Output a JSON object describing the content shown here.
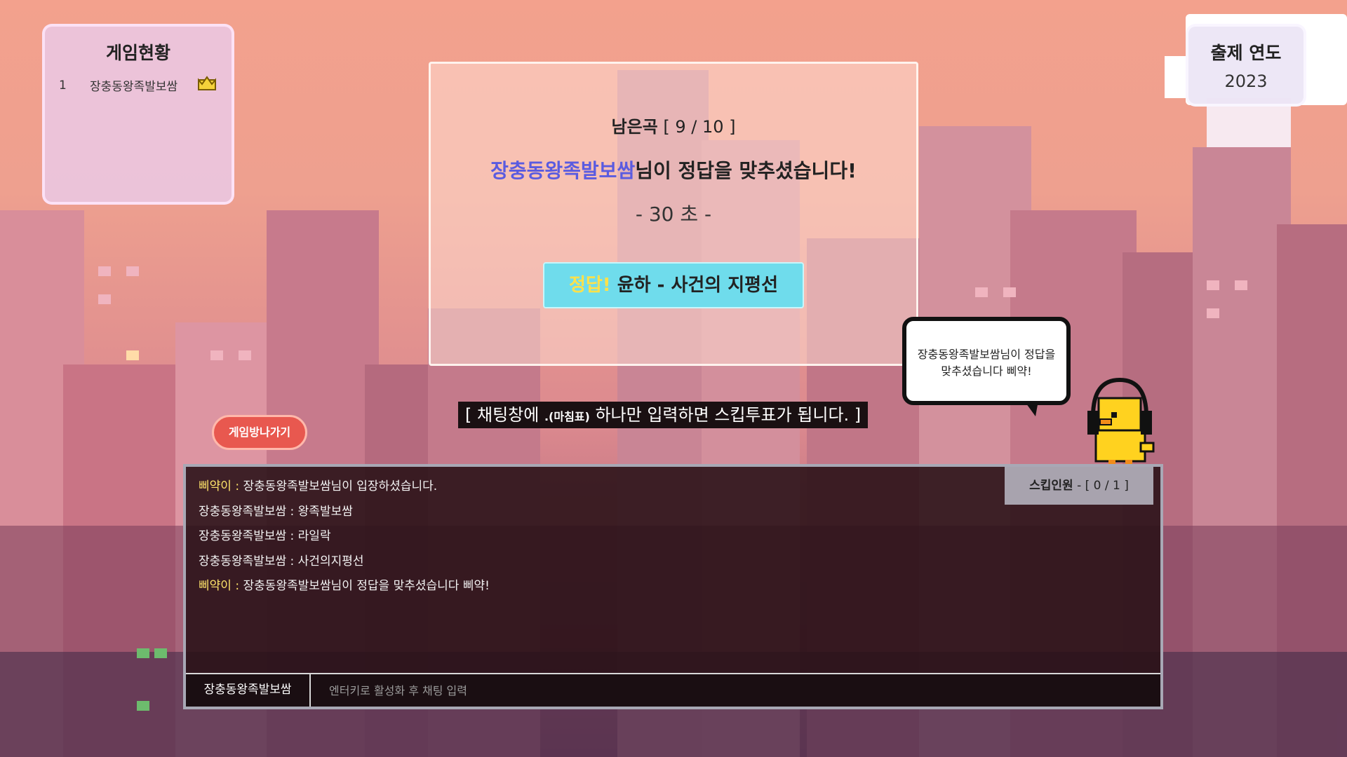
{
  "scoreboard": {
    "title": "게임현황",
    "players": [
      {
        "rank": "1",
        "name": "장충동왕족발보쌈"
      }
    ]
  },
  "year": {
    "title": "출제 연도",
    "value": "2023"
  },
  "panel": {
    "remaining_label": "남은곡",
    "remaining_value": "[ 9 / 10 ]",
    "winner_name": "장충동왕족발보쌈",
    "winner_suffix": "님이 정답을 맞추셨습니다!",
    "timer": "- 30 초 -",
    "answer_prefix": "정답!",
    "answer_text": "윤하 - 사건의 지평선"
  },
  "hint": {
    "pre": "[ 채팅창에 ",
    "dot": ".(마침표)",
    "post": " 하나만 입력하면 스킵투표가 됩니다. ]"
  },
  "leave_button": "게임방나가기",
  "bubble": {
    "line1": "장충동왕족발보쌈님이 정답을",
    "line2": "맞추셨습니다 삐약!"
  },
  "chat": {
    "messages": [
      {
        "sender": "삐약이",
        "sep": " : ",
        "text": "장충동왕족발보쌈님이 입장하셨습니다.",
        "system": true
      },
      {
        "sender": "장충동왕족발보쌈",
        "sep": " : ",
        "text": "왕족발보쌈",
        "system": false
      },
      {
        "sender": "장충동왕족발보쌈",
        "sep": " : ",
        "text": "라일락",
        "system": false
      },
      {
        "sender": "장충동왕족발보쌈",
        "sep": " : ",
        "text": "사건의지평선",
        "system": false
      },
      {
        "sender": "삐약이",
        "sep": " : ",
        "text": "장충동왕족발보쌈님이 정답을 맞추셨습니다 삐약!",
        "system": true
      }
    ],
    "skip_label": "스킵인원",
    "skip_value": " - [ 0 / 1 ]",
    "username": "장충동왕족발보쌈",
    "input_placeholder": "엔터키로 활성화 후 채팅 입력",
    "input_value": ""
  },
  "colors": {
    "winner_name": "#5a5be0",
    "system_sender": "#ffe46a",
    "answer_bg": "#6fdcec",
    "leave_btn": "#e8584f"
  },
  "icons": {
    "crown": "crown-icon",
    "duck": "duck-with-headphones-icon"
  }
}
